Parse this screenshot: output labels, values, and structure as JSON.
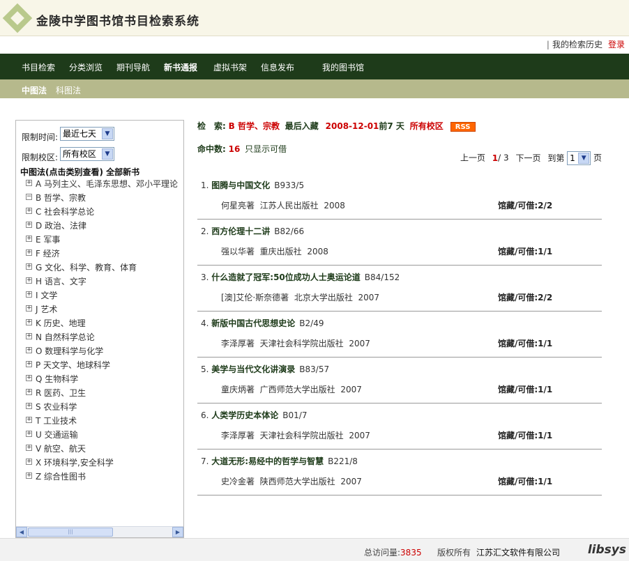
{
  "header": {
    "title": "金陵中学图书馆书目检索系统"
  },
  "toplinks": {
    "separator": "|",
    "history": "我的检索历史",
    "login": "登录"
  },
  "nav": [
    {
      "label": "书目检索",
      "active": false
    },
    {
      "label": "分类浏览",
      "active": false
    },
    {
      "label": "期刊导航",
      "active": false
    },
    {
      "label": "新书通报",
      "active": true
    },
    {
      "label": "虚拟书架",
      "active": false
    },
    {
      "label": "信息发布",
      "active": false
    },
    {
      "label": "我的图书馆",
      "active": false
    }
  ],
  "subnav": {
    "clc": "中图法",
    "sci": "科图法"
  },
  "sidebar": {
    "time_label": "限制时间:",
    "time_value": "最近七天",
    "campus_label": "限制校区:",
    "campus_value": "所有校区",
    "tree_title": "中图法(点击类别查看) 全部新书",
    "categories": [
      "A 马列主义、毛泽东思想、邓小平理论",
      "B 哲学、宗教",
      "C 社会科学总论",
      "D 政治、法律",
      "E 军事",
      "F 经济",
      "G 文化、科学、教育、体育",
      "H 语言、文字",
      "I 文学",
      "J 艺术",
      "K 历史、地理",
      "N 自然科学总论",
      "O 数理科学与化学",
      "P 天文学、地球科学",
      "Q 生物科学",
      "R 医药、卫生",
      "S 农业科学",
      "T 工业技术",
      "U 交通运输",
      "V 航空、航天",
      "X 环境科学,安全科学",
      "Z 综合性图书"
    ],
    "expanded_index": 1
  },
  "search": {
    "label": "检　索:",
    "category": "B 哲学、宗教",
    "latest_label": "最后入藏",
    "date": "2008-12-01",
    "before": "前7 天",
    "campus": "所有校区",
    "rss": "RSS",
    "hits_label": "命中数:",
    "hits": "16",
    "available_only": "只显示可借"
  },
  "pager": {
    "prev": "上一页",
    "current": "1",
    "total": "/ 3",
    "next": "下一页",
    "goto": "到第",
    "page_value": "1",
    "page_unit": "页"
  },
  "results": [
    {
      "num": "1.",
      "title": "图腾与中国文化",
      "call": "B933/5",
      "author": "何星亮著",
      "publisher": "江苏人民出版社",
      "year": "2008",
      "holding": "馆藏/可借:2/2"
    },
    {
      "num": "2.",
      "title": "西方伦理十二讲",
      "call": "B82/66",
      "author": "强以华著",
      "publisher": "重庆出版社",
      "year": "2008",
      "holding": "馆藏/可借:1/1"
    },
    {
      "num": "3.",
      "title": "什么造就了冠军:50位成功人士奥运论道",
      "call": "B84/152",
      "author": "[澳]艾伦·斯奈德著",
      "publisher": "北京大学出版社",
      "year": "2007",
      "holding": "馆藏/可借:2/2"
    },
    {
      "num": "4.",
      "title": "新版中国古代思想史论",
      "call": "B2/49",
      "author": "李泽厚著",
      "publisher": "天津社会科学院出版社",
      "year": "2007",
      "holding": "馆藏/可借:1/1"
    },
    {
      "num": "5.",
      "title": "美学与当代文化讲演录",
      "call": "B83/57",
      "author": "童庆炳著",
      "publisher": "广西师范大学出版社",
      "year": "2007",
      "holding": "馆藏/可借:1/1"
    },
    {
      "num": "6.",
      "title": "人类学历史本体论",
      "call": "B01/7",
      "author": "李泽厚著",
      "publisher": "天津社会科学院出版社",
      "year": "2007",
      "holding": "馆藏/可借:1/1"
    },
    {
      "num": "7.",
      "title": "大道无形:易经中的哲学与智慧",
      "call": "B221/8",
      "author": "史冷金著",
      "publisher": "陕西师范大学出版社",
      "year": "2007",
      "holding": "馆藏/可借:1/1"
    }
  ],
  "footer": {
    "visits_label": "总访问量:",
    "visits": "3835",
    "copyright": "版权所有",
    "company": "江苏汇文软件有限公司",
    "brand": "libsys"
  }
}
